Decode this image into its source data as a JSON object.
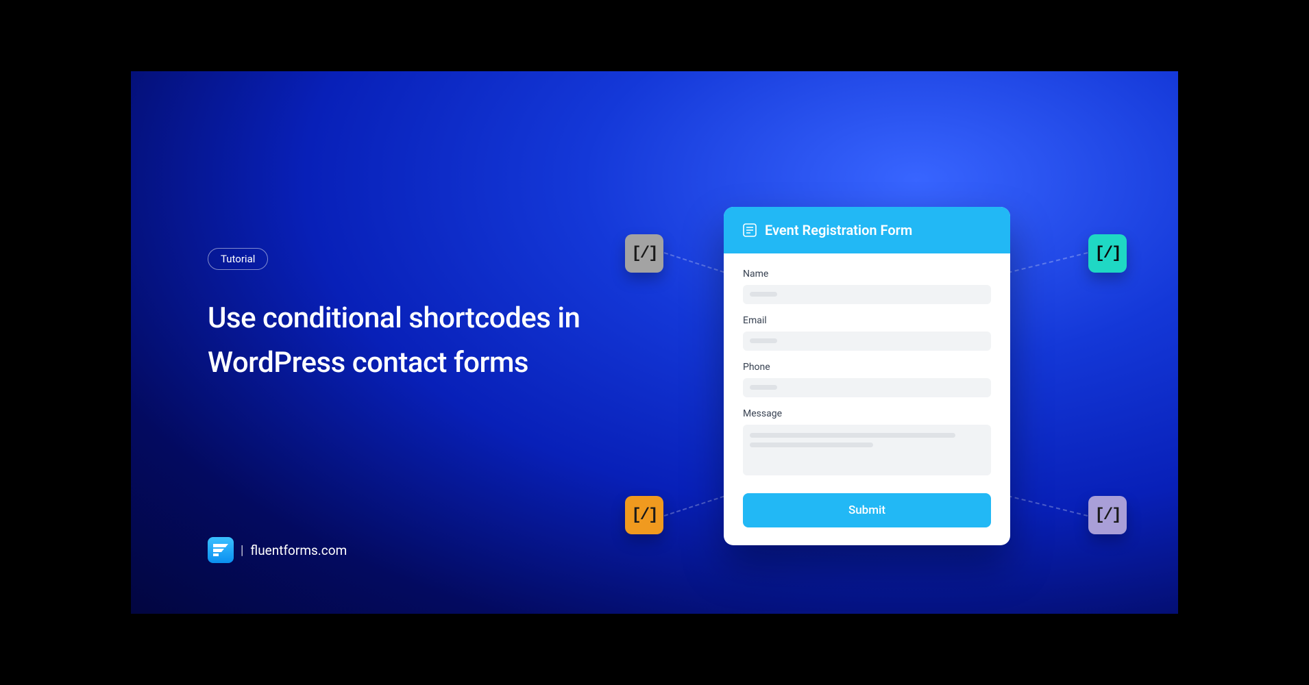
{
  "tag": "Tutorial",
  "headline": "Use conditional shortcodes in WordPress contact forms",
  "brand": "fluentforms.com",
  "form": {
    "title": "Event Registration Form",
    "fields": {
      "name": "Name",
      "email": "Email",
      "phone": "Phone",
      "message": "Message"
    },
    "submit": "Submit"
  },
  "shortcode_glyph": "[/]"
}
